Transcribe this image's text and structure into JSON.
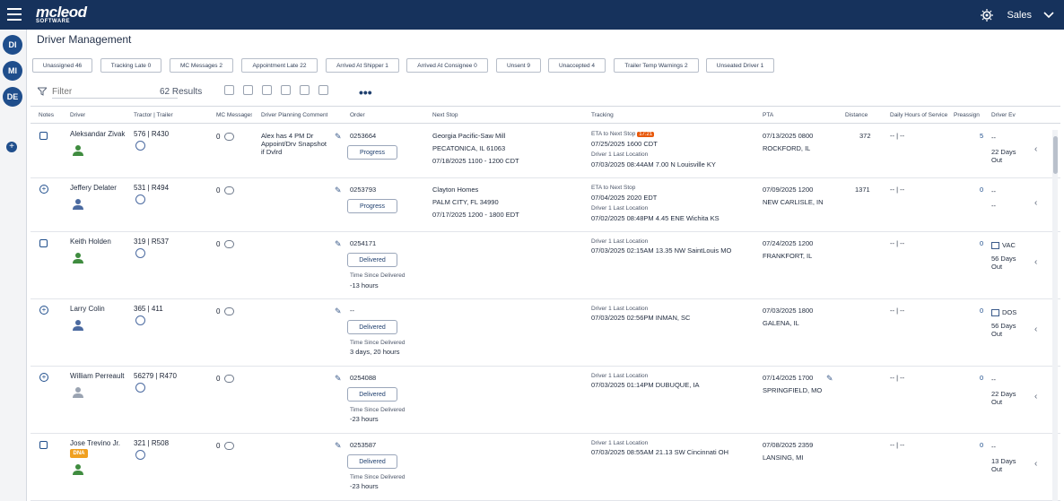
{
  "app": {
    "brand": "mcleod",
    "brand_sub": "SOFTWARE",
    "user_menu": "Sales"
  },
  "rail": [
    "DI",
    "MI",
    "DE"
  ],
  "page_title": "Driver Management",
  "chips": [
    {
      "label": "Unassigned 46"
    },
    {
      "label": "Tracking Late 0"
    },
    {
      "label": "MC Messages 2"
    },
    {
      "label": "Appointment Late 22"
    },
    {
      "label": "Arrived At Shipper 1"
    },
    {
      "label": "Arrived At Consignee 0"
    },
    {
      "label": "Unsent 9"
    },
    {
      "label": "Unaccepted 4"
    },
    {
      "label": "Trailer Temp Warnings 2"
    },
    {
      "label": "Unseated Driver 1"
    }
  ],
  "filter": {
    "placeholder": "Filter",
    "results": "62 Results"
  },
  "columns": [
    "Notes",
    "Driver",
    "Tractor | Trailer",
    "MC Messages",
    "Driver Planning Comment",
    "Order",
    "Next Stop",
    "Tracking",
    "PTA",
    "Distance",
    "Daily Hours of Service",
    "Preassign",
    "Driver Ev"
  ],
  "rows": [
    {
      "driver": "Aleksandar Zivak",
      "tractor": "576",
      "trailer": "R430",
      "mc": "0",
      "comment": [
        "Alex has 4 PM Dr",
        "Appoint/Drv Snapshot",
        "if Dvlrd"
      ],
      "order": "0253664",
      "order_btn": "Progress",
      "next_stop": [
        "Georgia Pacific-Saw Mill",
        "PECATONICA, IL 61063",
        "07/18/2025 1100 - 1200 CDT"
      ],
      "tracking": [
        "ETA to Next Stop",
        "17:21",
        "07/25/2025 1600 CDT",
        "Driver 1 Last Location",
        "07/03/2025 08:44AM 7.00 N Louisville KY"
      ],
      "pta": [
        "07/13/2025 0800",
        "ROCKFORD, IL"
      ],
      "distance": "372",
      "hos": "-- | --",
      "preassign": "5",
      "event": [
        "--",
        "22 Days",
        "Out"
      ]
    },
    {
      "driver": "Jeffery Delater",
      "tractor": "531",
      "trailer": "R494",
      "mc": "0",
      "order": "0253793",
      "order_btn": "Progress",
      "next_stop": [
        "Clayton Homes",
        "PALM CITY, FL 34990",
        "07/17/2025 1200 - 1800 EDT"
      ],
      "tracking": [
        "ETA to Next Stop",
        "07/04/2025 2020 EDT",
        "Driver 1 Last Location",
        "07/02/2025 08:48PM 4.45 ENE Wichita KS"
      ],
      "pta": [
        "07/09/2025 1200",
        "NEW CARLISLE, IN"
      ],
      "distance": "1371",
      "hos": "-- | --",
      "preassign": "0",
      "event": [
        "--",
        "--"
      ]
    },
    {
      "driver": "Keith Holden",
      "tractor": "319",
      "trailer": "R537",
      "mc": "0",
      "order": "0254171",
      "order_btn": "Delivered",
      "since": [
        "Time Since Delivered",
        "-13 hours"
      ],
      "tracking": [
        "Driver 1 Last Location",
        "07/03/2025 02:15AM 13.35 NW SaintLouis MO"
      ],
      "pta": [
        "07/24/2025 1200",
        "FRANKFORT, IL"
      ],
      "hos": "-- | --",
      "preassign": "0",
      "event": [
        "VAC",
        "56 Days",
        "Out"
      ]
    },
    {
      "driver": "Larry Colin",
      "tractor": "365",
      "trailer": "411",
      "mc": "0",
      "order": "--",
      "order_btn": "Delivered",
      "since": [
        "Time Since Delivered",
        "3 days, 20 hours"
      ],
      "tracking": [
        "Driver 1 Last Location",
        "07/03/2025 02:56PM INMAN, SC"
      ],
      "pta": [
        "07/03/2025 1800",
        "GALENA, IL"
      ],
      "hos": "-- | --",
      "preassign": "0",
      "event": [
        "DOS",
        "56 Days",
        "Out"
      ]
    },
    {
      "driver": "William Perreault",
      "tractor": "56279",
      "trailer": "R470",
      "mc": "0",
      "order": "0254088",
      "order_btn": "Delivered",
      "since": [
        "Time Since Delivered",
        "-23 hours"
      ],
      "tracking": [
        "Driver 1 Last Location",
        "07/03/2025 01:14PM DUBUQUE, IA"
      ],
      "pta": [
        "07/14/2025 1700",
        "SPRINGFIELD, MO"
      ],
      "hos": "-- | --",
      "preassign": "0",
      "event": [
        "--",
        "22 Days",
        "Out"
      ]
    },
    {
      "driver": "Jose Trevino Jr.",
      "tag": "DNA",
      "tractor": "321",
      "trailer": "R508",
      "mc": "0",
      "order": "0253587",
      "order_btn": "Delivered",
      "since": [
        "Time Since Delivered",
        "-23 hours"
      ],
      "tracking": [
        "Driver 1 Last Location",
        "07/03/2025 08:55AM 21.13 SW Cincinnati OH"
      ],
      "pta": [
        "07/08/2025 2359",
        "LANSING, MI"
      ],
      "hos": "-- | --",
      "preassign": "0",
      "event": [
        "--",
        "13 Days",
        "Out"
      ]
    }
  ]
}
